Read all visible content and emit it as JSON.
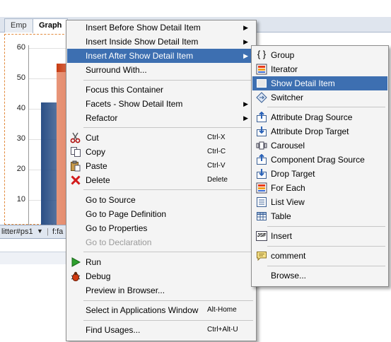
{
  "editor": {
    "tabs": [
      "Emp",
      "Graph"
    ],
    "y_axis_ticks": [
      "60",
      "50",
      "40",
      "30",
      "20",
      "10"
    ],
    "status_items": [
      "litter#ps1",
      "f:fa"
    ]
  },
  "chart_data": {
    "type": "bar",
    "categories": [],
    "series": [
      {
        "values": [
          42
        ]
      },
      {
        "values": [
          55
        ]
      },
      {
        "values": [
          52
        ]
      }
    ],
    "ylim": [
      0,
      60
    ],
    "colors": [
      "#2a4f86",
      "#c83c12",
      "#e8967a"
    ]
  },
  "context_menu": {
    "items": [
      {
        "label": "Insert Before Show Detail Item",
        "submenu": true
      },
      {
        "label": "Insert Inside Show Detail Item",
        "submenu": true
      },
      {
        "label": "Insert After Show Detail Item",
        "submenu": true,
        "highlighted": true
      },
      {
        "label": "Surround With..."
      },
      {
        "label": "Focus this Container"
      },
      {
        "label": "Facets - Show Detail Item",
        "submenu": true
      },
      {
        "label": "Refactor",
        "submenu": true
      },
      {
        "label": "Cut",
        "shortcut": "Ctrl-X",
        "icon": "scissors-icon"
      },
      {
        "label": "Copy",
        "shortcut": "Ctrl-C",
        "icon": "copy-icon"
      },
      {
        "label": "Paste",
        "shortcut": "Ctrl-V",
        "icon": "paste-icon"
      },
      {
        "label": "Delete",
        "shortcut": "Delete",
        "icon": "delete-icon"
      },
      {
        "label": "Go to Source"
      },
      {
        "label": "Go to Page Definition"
      },
      {
        "label": "Go to Properties"
      },
      {
        "label": "Go to Declaration",
        "disabled": true
      },
      {
        "label": "Run",
        "icon": "run-icon"
      },
      {
        "label": "Debug",
        "icon": "debug-icon"
      },
      {
        "label": "Preview in Browser..."
      },
      {
        "label": "Select in Applications Window",
        "shortcut": "Alt-Home"
      },
      {
        "label": "Find Usages...",
        "shortcut": "Ctrl+Alt-U"
      }
    ]
  },
  "submenu": {
    "items": [
      {
        "label": "Group",
        "icon": "group-icon"
      },
      {
        "label": "Iterator",
        "icon": "iterator-icon"
      },
      {
        "label": "Show Detail Item",
        "icon": "show-detail-item-icon",
        "highlighted": true
      },
      {
        "label": "Switcher",
        "icon": "switcher-icon"
      },
      {
        "label": "Attribute Drag Source",
        "icon": "drag-source-icon"
      },
      {
        "label": "Attribute Drop Target",
        "icon": "drop-target-icon"
      },
      {
        "label": "Carousel",
        "icon": "carousel-icon"
      },
      {
        "label": "Component Drag Source",
        "icon": "component-drag-icon"
      },
      {
        "label": "Drop Target",
        "icon": "drop-target-icon"
      },
      {
        "label": "For Each",
        "icon": "for-each-icon"
      },
      {
        "label": "List View",
        "icon": "list-view-icon"
      },
      {
        "label": "Table",
        "icon": "table-icon"
      },
      {
        "label": "Insert",
        "icon": "jsf-insert-icon",
        "icon_text": "JSF"
      },
      {
        "label": "comment",
        "icon": "comment-icon"
      },
      {
        "label": "Browse..."
      }
    ]
  },
  "colors": {
    "highlight": "#3d6fb1",
    "menu_bg": "#f4f4f4",
    "design_border": "#e28a3c"
  }
}
